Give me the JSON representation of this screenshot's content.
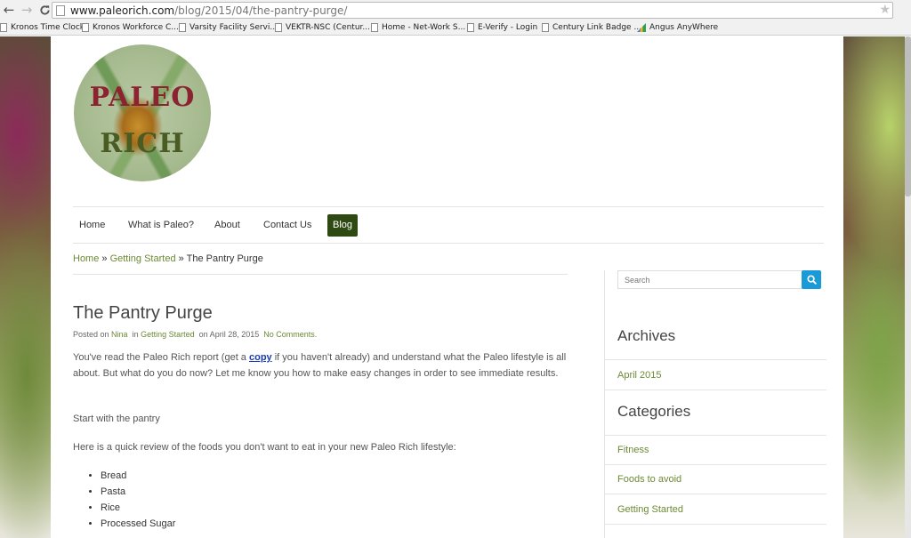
{
  "browser": {
    "url_host": "www.paleorich.com",
    "url_path": "/blog/2015/04/the-pantry-purge/",
    "bookmarks": [
      "Kronos Time Clock",
      "Kronos Workforce C...",
      "Varsity Facility Servi...",
      "VEKTR-NSC (Centur...",
      "Home - Net-Work S...",
      "E-Verify - Login",
      "Century Link Badge ...",
      "Angus AnyWhere"
    ]
  },
  "logo": {
    "line1": "PALEO",
    "line2": "RICH"
  },
  "nav": [
    "Home",
    "What is Paleo?",
    "About",
    "Contact Us",
    "Blog"
  ],
  "breadcrumb": {
    "home": "Home",
    "sep": " » ",
    "category": "Getting Started",
    "current": "The Pantry Purge"
  },
  "post": {
    "title": "The Pantry Purge",
    "meta_posted_on": "Posted on",
    "meta_author": "Nina",
    "meta_in": "in",
    "meta_category": "Getting Started",
    "meta_date": "on April 28, 2015",
    "meta_comments": "No Comments.",
    "p1_before": "You've read the Paleo Rich report (get a ",
    "p1_link": "copy",
    "p1_after": " if you haven't already) and understand what the Paleo lifestyle is all about. But what do you do now? Let me know you how to make easy changes in order to see immediate results.",
    "p2": "Start with the pantry",
    "p3": "Here is a quick review of the foods you don't want to eat in your new Paleo Rich lifestyle:",
    "foods": [
      "Bread",
      "Pasta",
      "Rice",
      "Processed Sugar"
    ]
  },
  "sidebar": {
    "search_placeholder": "Search",
    "archives_title": "Archives",
    "archives": [
      "April 2015"
    ],
    "categories_title": "Categories",
    "categories": [
      "Fitness",
      "Foods to avoid",
      "Getting Started"
    ]
  },
  "colors": {
    "accent_green": "#6c8a34",
    "nav_active": "#2e4a12",
    "search_blue": "#1a9bd7"
  }
}
